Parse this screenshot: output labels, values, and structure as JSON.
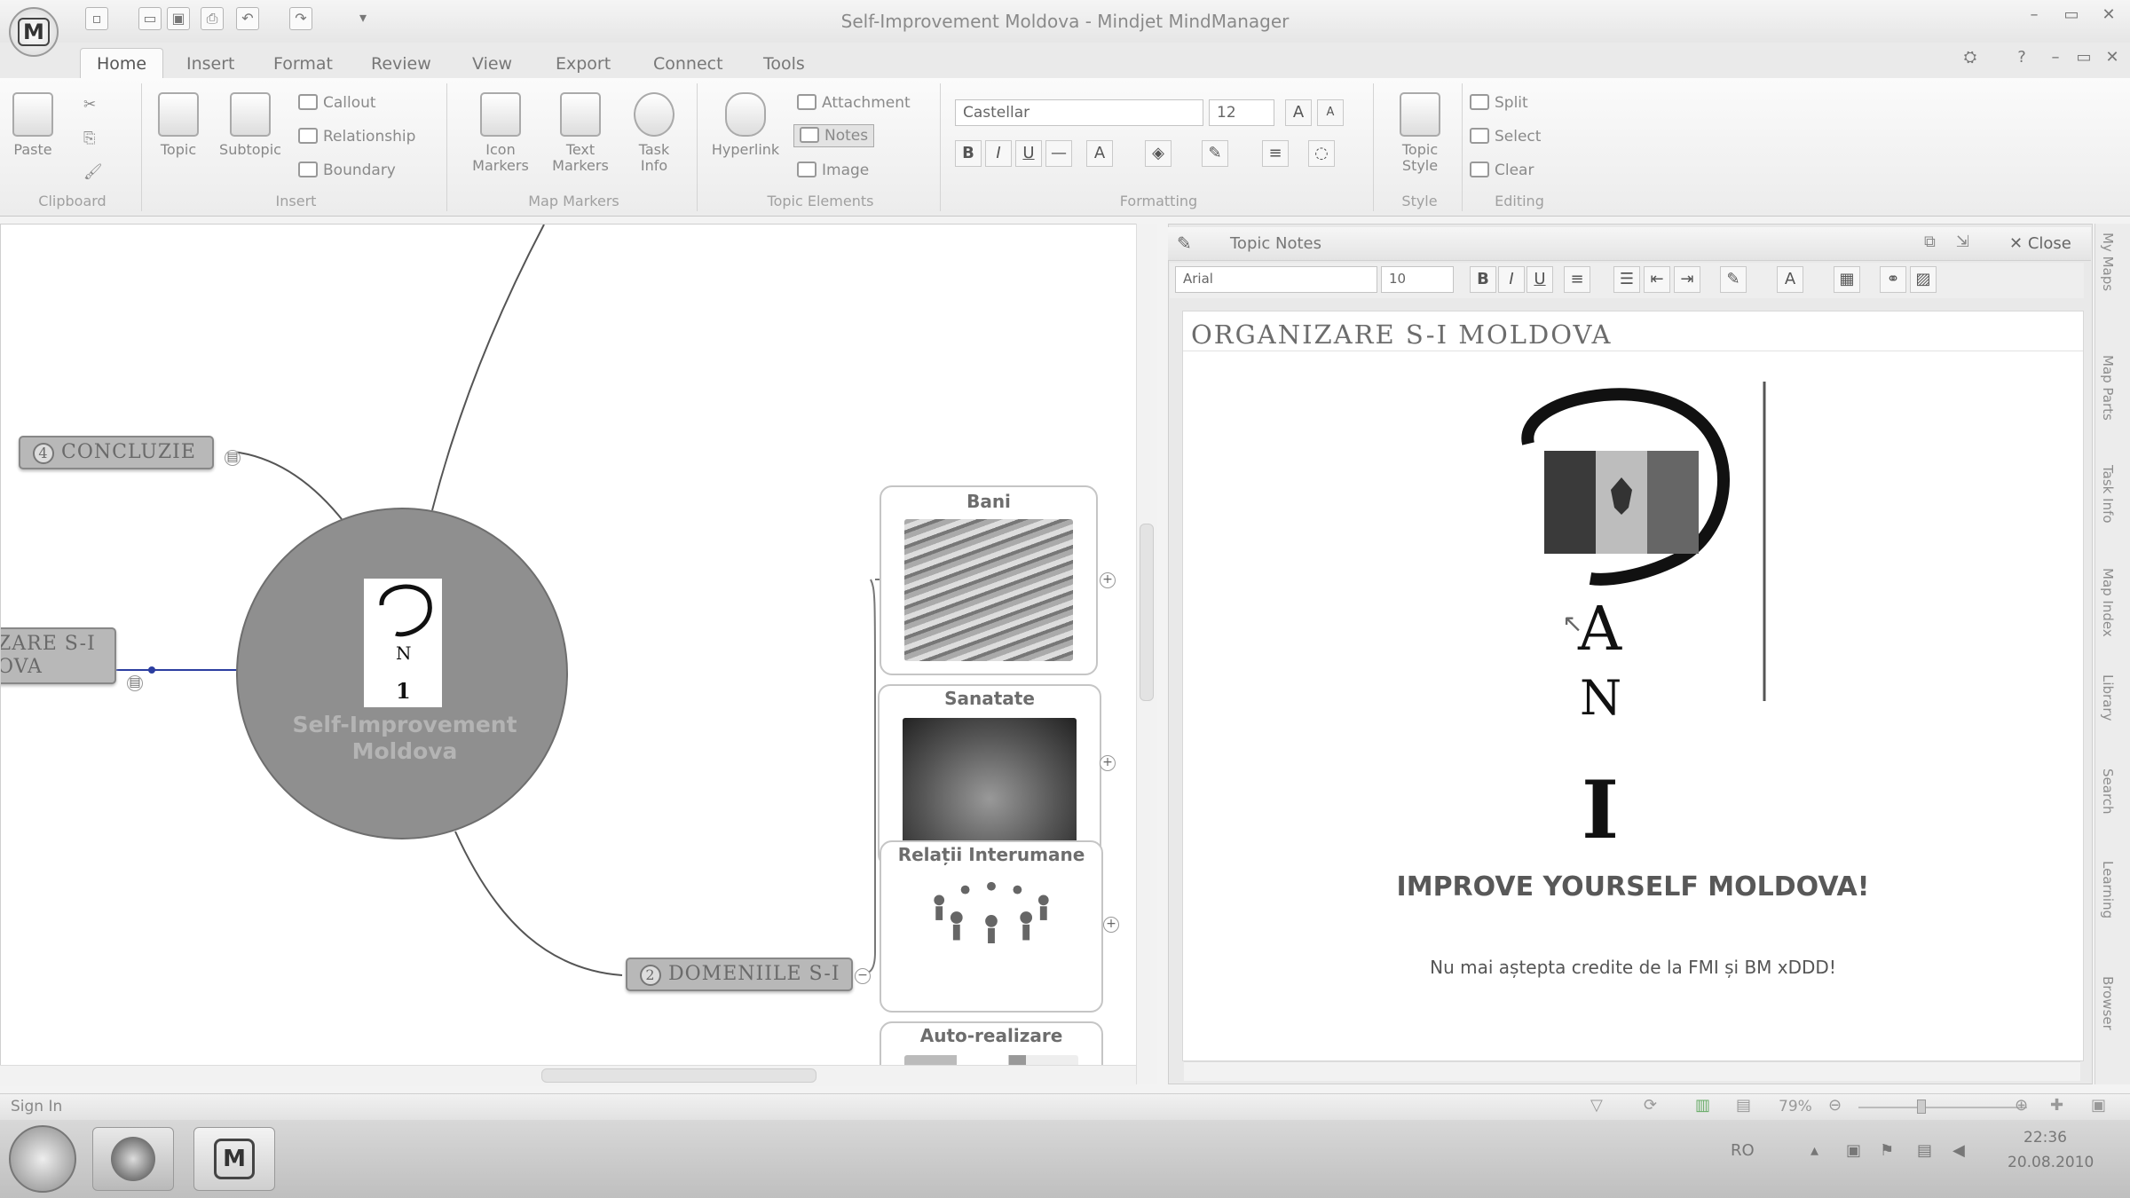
{
  "window": {
    "title": "Self-Improvement Moldova - Mindjet MindManager",
    "app_button": "M"
  },
  "tabs": [
    "Home",
    "Insert",
    "Format",
    "Review",
    "View",
    "Export",
    "Connect",
    "Tools"
  ],
  "ribbon": {
    "clipboard": {
      "paste": "Paste",
      "label": "Clipboard"
    },
    "insert": {
      "topic": "Topic",
      "subtopic": "Subtopic",
      "callout": "Callout",
      "relationship": "Relationship",
      "boundary": "Boundary",
      "label": "Insert"
    },
    "map_markers": {
      "icon_markers_1": "Icon",
      "icon_markers_2": "Markers",
      "text_markers_1": "Text",
      "text_markers_2": "Markers",
      "task_info_1": "Task",
      "task_info_2": "Info",
      "label": "Map Markers"
    },
    "topic_elements": {
      "hyperlink": "Hyperlink",
      "attachment": "Attachment",
      "notes": "Notes",
      "image": "Image",
      "label": "Topic Elements"
    },
    "formatting": {
      "font": "Castellar",
      "size": "12",
      "label": "Formatting",
      "bold": "B",
      "italic": "I",
      "underline": "U",
      "grow": "A",
      "shrink": "A"
    },
    "style": {
      "topic_style_1": "Topic",
      "topic_style_2": "Style",
      "label": "Style"
    },
    "editing": {
      "split": "Split",
      "select": "Select",
      "clear": "Clear",
      "label": "Editing"
    }
  },
  "map": {
    "central": {
      "line1": "Self-Improvement",
      "line2": "Moldova",
      "logo_letters": "N",
      "logo_number": "1"
    },
    "topics": [
      {
        "num": "4",
        "label": "CONCLUZIE"
      },
      {
        "num": "",
        "label": "ZARE S-I",
        "label2": "OVA"
      },
      {
        "num": "2",
        "label": "DOMENIILE S-I"
      }
    ],
    "subtopics": [
      {
        "label": "Bani"
      },
      {
        "label": "Sanatate"
      },
      {
        "label": "Relații Interumane"
      },
      {
        "label": "Auto-realizare"
      }
    ]
  },
  "notes": {
    "panel_title": "Topic Notes",
    "close": "Close",
    "font": "Arial",
    "size": "10",
    "doc_title": "ORGANIZARE S-I MOLDOVA",
    "logo_a": "A",
    "logo_n": "N",
    "logo_i": "I",
    "heading": "IMPROVE YOURSELF MOLDOVA!",
    "subtext": "Nu mai aștepta credite de la FMI și BM xDDD!"
  },
  "sidebar_tabs": [
    "My Maps",
    "Map Parts",
    "Task Info",
    "Map Index",
    "Library",
    "Search",
    "Learning",
    "Browser"
  ],
  "status": {
    "sign_in": "Sign In",
    "zoom": "79%"
  },
  "taskbar": {
    "lang": "RO",
    "time": "22:36",
    "date": "20.08.2010"
  },
  "colors": {
    "ribbon_bg": "#f3f3f3",
    "topic_fill": "#b8b8b8",
    "central_fill": "#8f8f8f",
    "line": "#555555"
  }
}
